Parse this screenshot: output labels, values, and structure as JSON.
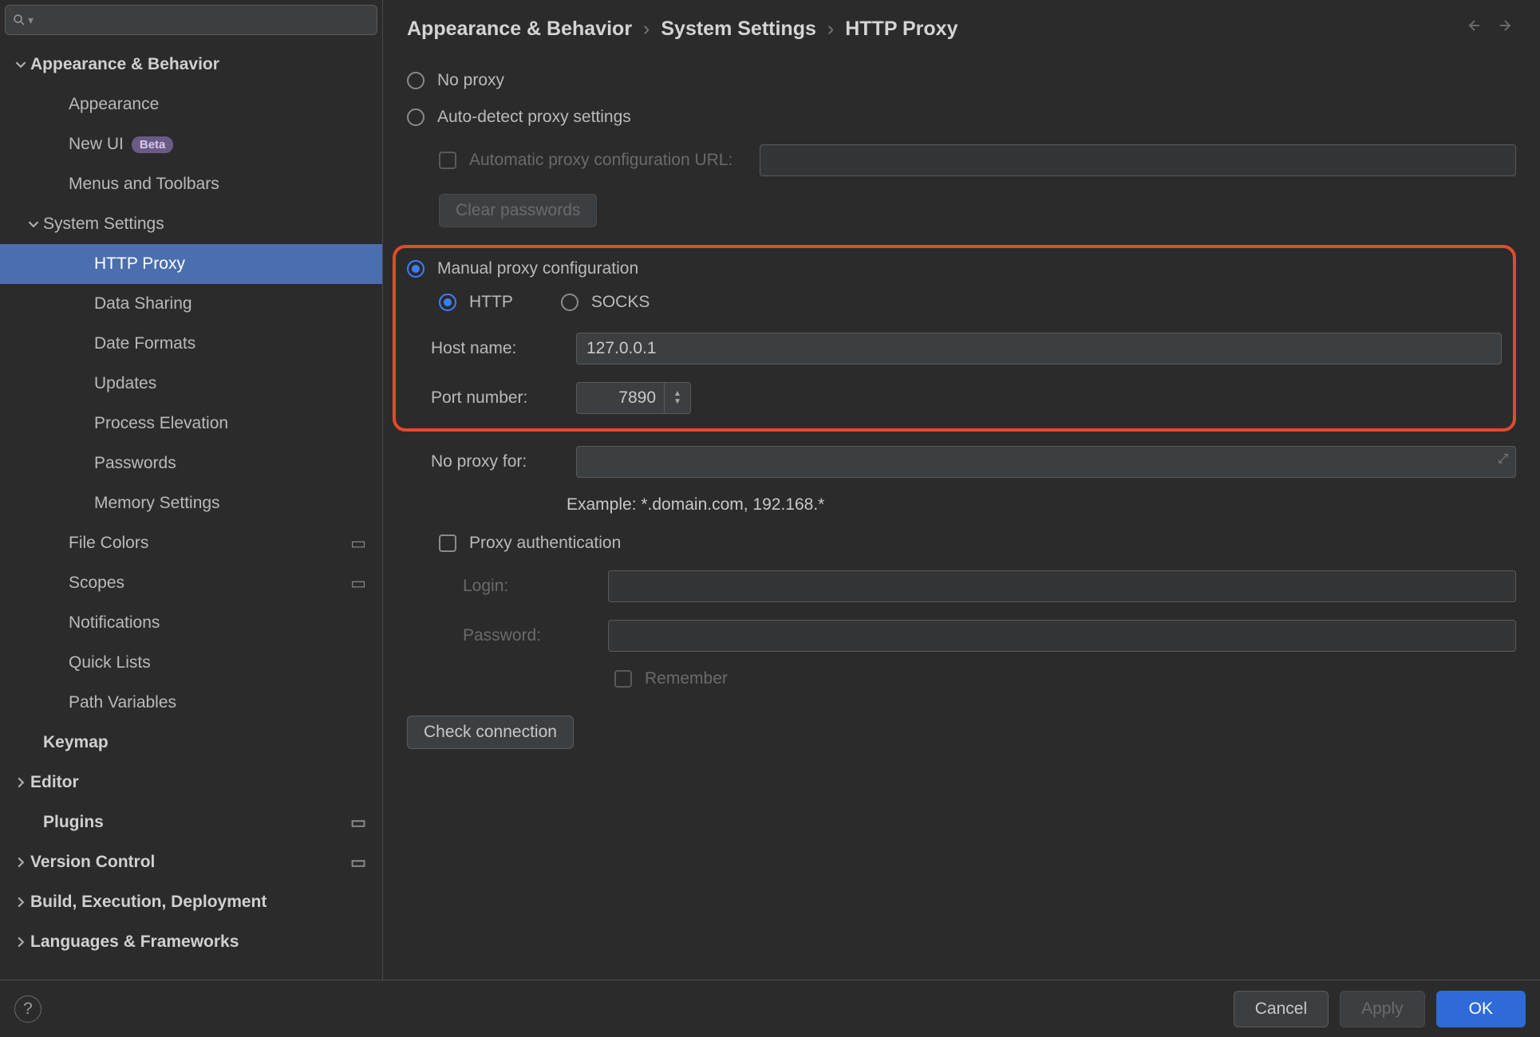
{
  "breadcrumb": {
    "a": "Appearance & Behavior",
    "b": "System Settings",
    "c": "HTTP Proxy"
  },
  "sidebar": {
    "appearance_behavior": "Appearance & Behavior",
    "appearance": "Appearance",
    "new_ui": "New UI",
    "new_ui_badge": "Beta",
    "menus_toolbars": "Menus and Toolbars",
    "system_settings": "System Settings",
    "http_proxy": "HTTP Proxy",
    "data_sharing": "Data Sharing",
    "date_formats": "Date Formats",
    "updates": "Updates",
    "process_elevation": "Process Elevation",
    "passwords": "Passwords",
    "memory_settings": "Memory Settings",
    "file_colors": "File Colors",
    "scopes": "Scopes",
    "notifications": "Notifications",
    "quick_lists": "Quick Lists",
    "path_variables": "Path Variables",
    "keymap": "Keymap",
    "editor": "Editor",
    "plugins": "Plugins",
    "version_control": "Version Control",
    "build": "Build, Execution, Deployment",
    "languages": "Languages & Frameworks"
  },
  "form": {
    "no_proxy": "No proxy",
    "auto_detect": "Auto-detect proxy settings",
    "auto_url_label": "Automatic proxy configuration URL:",
    "clear_passwords": "Clear passwords",
    "manual": "Manual proxy configuration",
    "http": "HTTP",
    "socks": "SOCKS",
    "host_label": "Host name:",
    "host_value": "127.0.0.1",
    "port_label": "Port number:",
    "port_value": "7890",
    "noproxy_label": "No proxy for:",
    "example": "Example: *.domain.com, 192.168.*",
    "proxy_auth": "Proxy authentication",
    "login_label": "Login:",
    "password_label": "Password:",
    "remember": "Remember",
    "check_connection": "Check connection"
  },
  "footer": {
    "cancel": "Cancel",
    "apply": "Apply",
    "ok": "OK"
  }
}
